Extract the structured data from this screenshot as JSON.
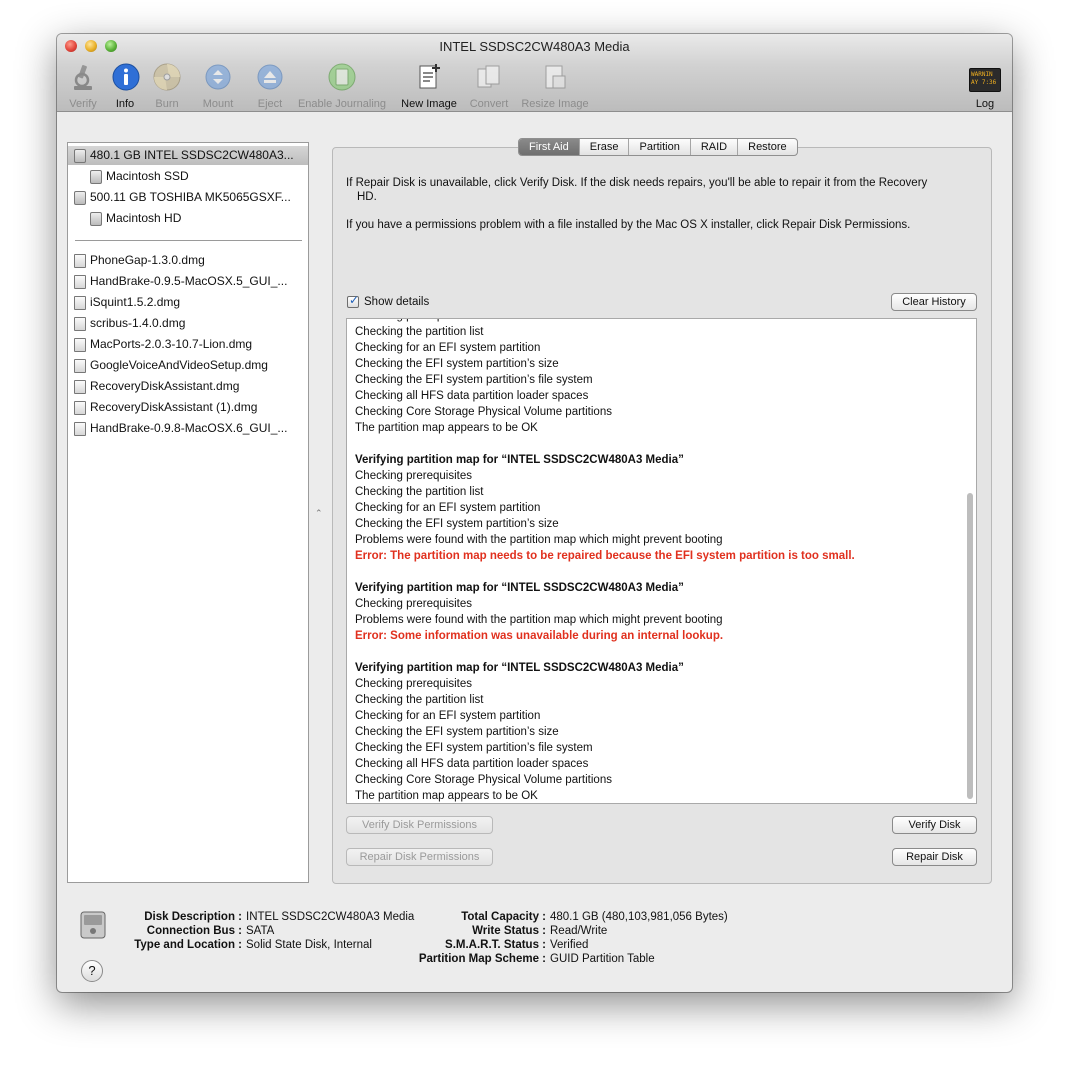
{
  "window": {
    "title": "INTEL SSDSC2CW480A3 Media"
  },
  "toolbar": {
    "verify": "Verify",
    "info": "Info",
    "burn": "Burn",
    "mount": "Mount",
    "eject": "Eject",
    "enable_journaling": "Enable Journaling",
    "new_image": "New Image",
    "convert": "Convert",
    "resize_image": "Resize Image",
    "log": "Log",
    "log_icon_text": "WARNIN\nAY 7:36"
  },
  "sidebar": {
    "disks": [
      {
        "label": "480.1 GB INTEL SSDSC2CW480A3...",
        "selected": true
      },
      {
        "label": "Macintosh SSD"
      },
      {
        "label": "500.11 GB TOSHIBA MK5065GSXF..."
      },
      {
        "label": "Macintosh HD"
      }
    ],
    "images": [
      "PhoneGap-1.3.0.dmg",
      "HandBrake-0.9.5-MacOSX.5_GUI_...",
      "iSquint1.5.2.dmg",
      "scribus-1.4.0.dmg",
      "MacPorts-2.0.3-10.7-Lion.dmg",
      "GoogleVoiceAndVideoSetup.dmg",
      "RecoveryDiskAssistant.dmg",
      "RecoveryDiskAssistant (1).dmg",
      "HandBrake-0.9.8-MacOSX.6_GUI_..."
    ]
  },
  "tabs": [
    "First Aid",
    "Erase",
    "Partition",
    "RAID",
    "Restore"
  ],
  "first_aid": {
    "intro_line1": "If Repair Disk is unavailable, click Verify Disk. If the disk needs repairs, you'll be able to repair it from the Recovery",
    "intro_line1b": "HD.",
    "intro_line2": "If you have a permissions problem with a file installed by the Mac OS X installer, click Repair Disk Permissions.",
    "show_details": "Show details",
    "clear_history": "Clear History",
    "verify_disk_permissions": "Verify Disk Permissions",
    "repair_disk_permissions": "Repair Disk Permissions",
    "verify_disk": "Verify Disk",
    "repair_disk": "Repair Disk",
    "log": [
      {
        "text": "Checking prerequisites",
        "style": "normal"
      },
      {
        "text": "Checking the partition list",
        "style": "normal"
      },
      {
        "text": "Checking for an EFI system partition",
        "style": "normal"
      },
      {
        "text": "Checking the EFI system partition’s size",
        "style": "normal"
      },
      {
        "text": "Checking the EFI system partition’s file system",
        "style": "normal"
      },
      {
        "text": "Checking all HFS data partition loader spaces",
        "style": "normal"
      },
      {
        "text": "Checking Core Storage Physical Volume partitions",
        "style": "normal"
      },
      {
        "text": "The partition map appears to be OK",
        "style": "normal"
      },
      {
        "text": "",
        "style": "normal"
      },
      {
        "text": "Verifying partition map for “INTEL SSDSC2CW480A3 Media”",
        "style": "bold"
      },
      {
        "text": "Checking prerequisites",
        "style": "normal"
      },
      {
        "text": "Checking the partition list",
        "style": "normal"
      },
      {
        "text": "Checking for an EFI system partition",
        "style": "normal"
      },
      {
        "text": "Checking the EFI system partition’s size",
        "style": "normal"
      },
      {
        "text": "Problems were found with the partition map which might prevent booting",
        "style": "normal"
      },
      {
        "text": "Error: The partition map needs to be repaired because the EFI system partition is too small.",
        "style": "error"
      },
      {
        "text": "",
        "style": "normal"
      },
      {
        "text": "Verifying partition map for “INTEL SSDSC2CW480A3 Media”",
        "style": "bold"
      },
      {
        "text": "Checking prerequisites",
        "style": "normal"
      },
      {
        "text": "Problems were found with the partition map which might prevent booting",
        "style": "normal"
      },
      {
        "text": "Error: Some information was unavailable during an internal lookup.",
        "style": "error"
      },
      {
        "text": "",
        "style": "normal"
      },
      {
        "text": "Verifying partition map for “INTEL SSDSC2CW480A3 Media”",
        "style": "bold"
      },
      {
        "text": "Checking prerequisites",
        "style": "normal"
      },
      {
        "text": "Checking the partition list",
        "style": "normal"
      },
      {
        "text": "Checking for an EFI system partition",
        "style": "normal"
      },
      {
        "text": "Checking the EFI system partition’s size",
        "style": "normal"
      },
      {
        "text": "Checking the EFI system partition’s file system",
        "style": "normal"
      },
      {
        "text": "Checking all HFS data partition loader spaces",
        "style": "normal"
      },
      {
        "text": "Checking Core Storage Physical Volume partitions",
        "style": "normal"
      },
      {
        "text": "The partition map appears to be OK",
        "style": "normal"
      }
    ]
  },
  "disk_info": {
    "left": [
      {
        "label": "Disk Description :",
        "value": "INTEL SSDSC2CW480A3 Media"
      },
      {
        "label": "Connection Bus :",
        "value": "SATA"
      },
      {
        "label": "Type and Location :",
        "value": "Solid State Disk, Internal"
      }
    ],
    "right": [
      {
        "label": "Total Capacity :",
        "value": "480.1 GB (480,103,981,056 Bytes)"
      },
      {
        "label": "Write Status :",
        "value": "Read/Write"
      },
      {
        "label": "S.M.A.R.T. Status :",
        "value": "Verified"
      },
      {
        "label": "Partition Map Scheme :",
        "value": "GUID Partition Table"
      }
    ],
    "help": "?"
  },
  "colors": {
    "error": "#e0301e",
    "info_blue": "#2f6fd6",
    "selection": "#c8c8c8"
  }
}
